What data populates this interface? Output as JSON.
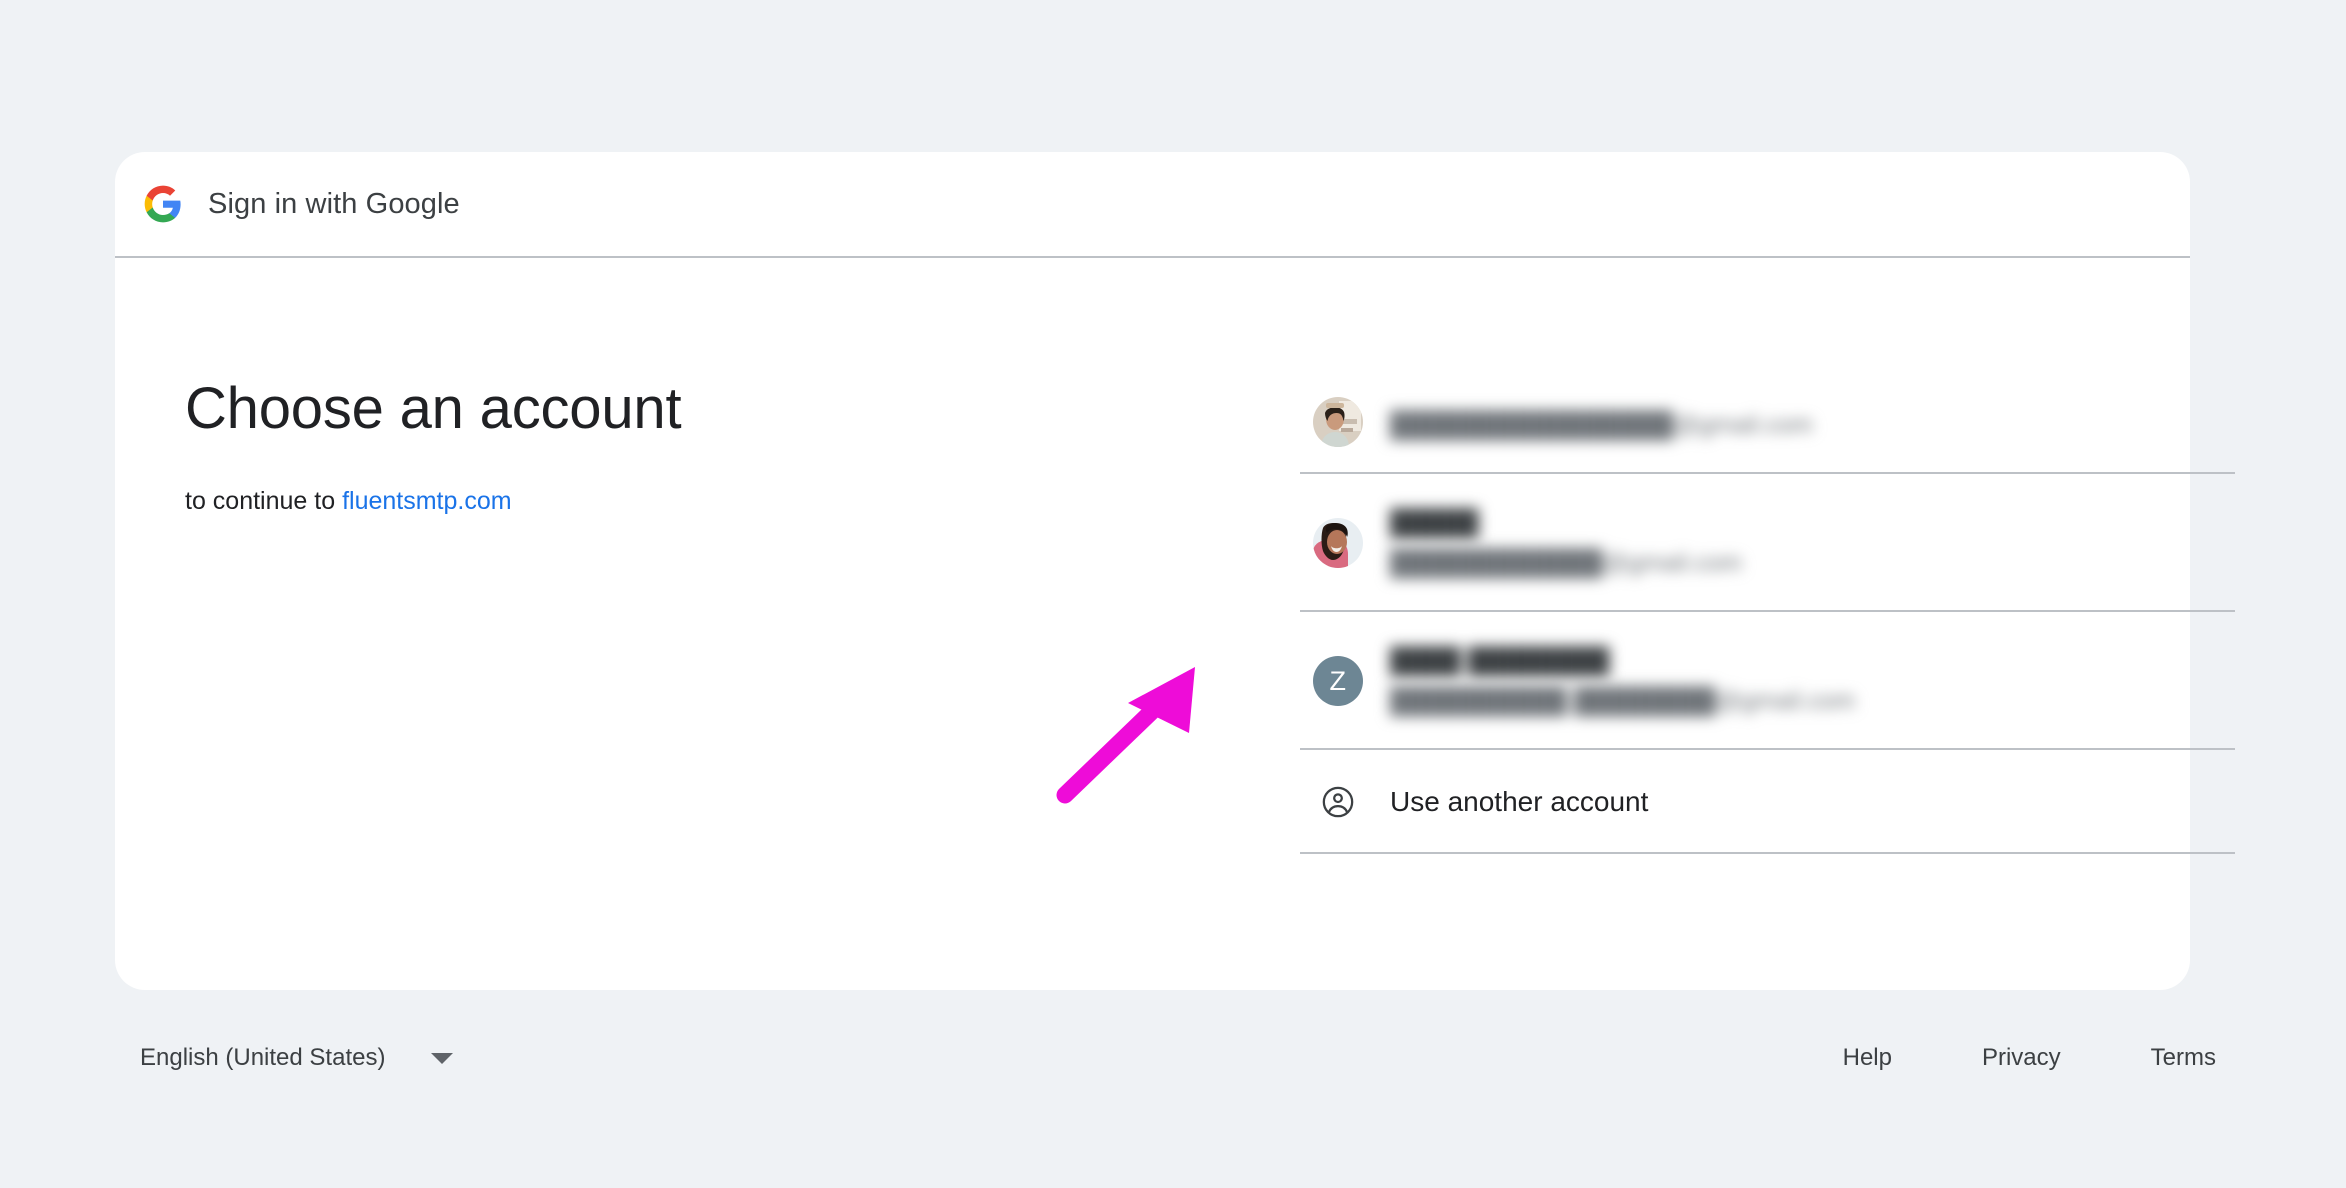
{
  "page": {
    "background_color": "#eff2f5",
    "card_background": "#ffffff"
  },
  "header": {
    "logo_icon": "google-g-icon",
    "title": "Sign in with Google",
    "divider_color": "#bdc1c6"
  },
  "main": {
    "headline": "Choose an account",
    "continue_prefix": "to continue to ",
    "continue_site": "fluentsmtp.com",
    "link_color": "#1a73e8"
  },
  "accounts": [
    {
      "avatar_type": "photo",
      "avatar_name": "account-avatar-photo-1",
      "name": "",
      "email": "████████████████@gmail.com",
      "redacted": true
    },
    {
      "avatar_type": "photo",
      "avatar_name": "account-avatar-photo-2",
      "name": "█████",
      "email": "████████████@gmail.com",
      "redacted": true
    },
    {
      "avatar_type": "letter",
      "avatar_name": "account-avatar-letter-z",
      "avatar_letter": "Z",
      "avatar_color": "#6d8694",
      "name": "████ ████████",
      "email": "██████████.████████@gmail.com",
      "redacted": true
    }
  ],
  "use_another": {
    "icon": "account-circle-icon",
    "label": "Use another account"
  },
  "footer": {
    "language": "English (United States)",
    "language_caret_icon": "chevron-down-icon",
    "links": [
      {
        "label": "Help"
      },
      {
        "label": "Privacy"
      },
      {
        "label": "Terms"
      }
    ]
  },
  "annotation": {
    "type": "arrow",
    "color": "#ee0cd8",
    "points_to": "account-avatar-letter-z"
  }
}
